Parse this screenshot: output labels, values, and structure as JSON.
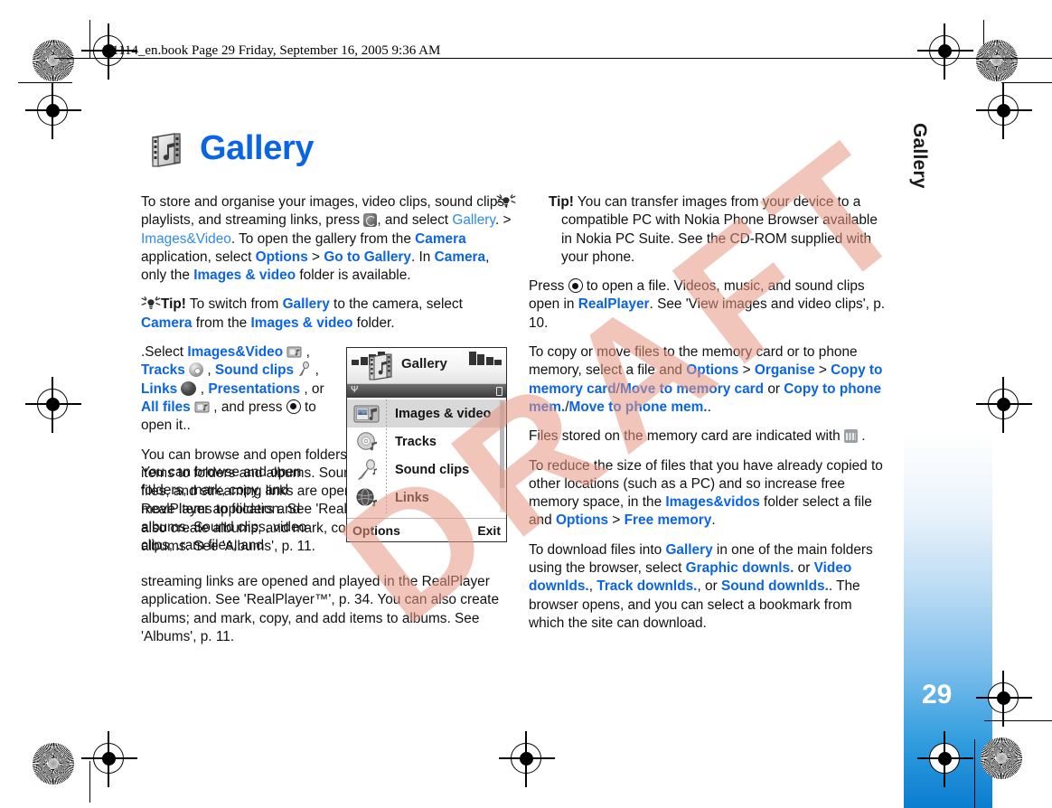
{
  "header": {
    "text": "R1114_en.book  Page 29  Friday, September 16, 2005  9:36 AM"
  },
  "chapter": {
    "title": "Gallery",
    "side_tab_label": "Gallery",
    "page_number": "29",
    "icon": "film-music-icon"
  },
  "watermark": {
    "text": "DRAFT",
    "color": "#e89682"
  },
  "colors": {
    "link_blue": "#0a64e6",
    "light_blue": "#2f8bea",
    "side_band_blue": "#0b7fd4"
  },
  "left_column": {
    "p1": {
      "t1": "To store and organise your images, video clips, sound clips, playlists, and streaming links, press ",
      "icon1": "menu-key-icon",
      "t2": ", and select ",
      "link1": "Gallery",
      "t3": ". > ",
      "link2": "Images&Video",
      "t4": ". To open the gallery from the ",
      "link3": "Camera",
      "t5": " application, select ",
      "link4": "Options",
      "t6": " > ",
      "link5": "Go to Gallery",
      "t7": ". In ",
      "link6": "Camera",
      "t8": ", only the ",
      "link7": "Images & video",
      "t9": " folder is available."
    },
    "tip1": {
      "icon": "lightbulb-icon",
      "label": "Tip!",
      "t1": " To switch from ",
      "link1": "Gallery",
      "t2": " to the camera, select ",
      "link2": "Camera",
      "t3": " from the ",
      "link3": "Images & video",
      "t4": " folder."
    },
    "p2": {
      "t1": ".Select ",
      "link1": "Images&Video",
      "icon1": "film-folder-icon",
      "t2": " , ",
      "link2": "Tracks",
      "icon2": "disc-icon",
      "t3": " , ",
      "link3": "Sound clips",
      "icon3": "microphone-icon",
      "t4": " , ",
      "link4": "Links",
      "icon4": "globe-icon",
      "t5": " , ",
      "link5": "Presentations",
      "t6": " , or ",
      "link6": "All files",
      "icon5": "film-folder-icon",
      "t7": " , and press ",
      "icon6": "scroll-key-icon",
      "t8": " to open it.."
    },
    "p3": {
      "t1": "You can browse and open folders, mark, copy, and move items to folders and albums. Sound clips, video clips, .ram files, and streaming links are opened and played in the RealPlayer application. See 'RealPlayer™', p. 34. You can also create albums; and mark, copy, and add items to albums. See 'Albums', p. 11."
    }
  },
  "right_column": {
    "tip2": {
      "icon": "lightbulb-icon",
      "label": "Tip!",
      "t1": " You can transfer images from your device to a compatible PC with Nokia Phone Browser available in Nokia PC Suite. See the CD-ROM supplied with your phone."
    },
    "p1": {
      "t1": "Press ",
      "icon1": "scroll-key-icon",
      "t2": " to open a file. Videos, music, and sound clips open in ",
      "link1": "RealPlayer",
      "t3": ". See 'View images and video clips', p. 10."
    },
    "p2": {
      "t1": "To copy or move files to the memory card or to phone memory, select a file and ",
      "link1": "Options",
      "t2": " > ",
      "link2": "Organise",
      "t3": " > ",
      "link3": "Copy to memory card",
      "t4": "/",
      "link4": "Move to memory card",
      "t5": " or ",
      "link5": "Copy to phone mem.",
      "t6": "/",
      "link6": "Move to phone mem.",
      "t7": "."
    },
    "p3": {
      "t1": "Files stored on the memory card are indicated with ",
      "icon1": "memory-card-icon",
      "t2": " ."
    },
    "p4": {
      "t1": "To reduce the size of files that you have already copied to other locations (such as a PC) and so increase free memory space, in the ",
      "link1": "Images&vidos",
      "t2": " folder select a file and ",
      "link2": "Options",
      "t3": " > ",
      "link3": "Free memory",
      "t4": "."
    },
    "p5": {
      "t1": "To download files into ",
      "link1": "Gallery",
      "t2": " in one of the main folders using the browser, select ",
      "link2": "Graphic downls.",
      "t3": " or ",
      "link3": "Video downlds.",
      "t4": ", ",
      "link4": "Track downlds.",
      "t5": ", or ",
      "link5": "Sound downlds.",
      "t6": ". The browser opens, and you can select a bookmark from which the site can download."
    }
  },
  "phone_screenshot": {
    "title": "Gallery",
    "softkey_left": "Options",
    "softkey_right": "Exit",
    "items": [
      {
        "label": "Images & video",
        "icon": "images-video-icon",
        "selected": true
      },
      {
        "label": "Tracks",
        "icon": "disc-icon",
        "selected": false
      },
      {
        "label": "Sound clips",
        "icon": "microphone-icon",
        "selected": false
      },
      {
        "label": "Links",
        "icon": "globe-icon",
        "selected": false
      }
    ]
  }
}
